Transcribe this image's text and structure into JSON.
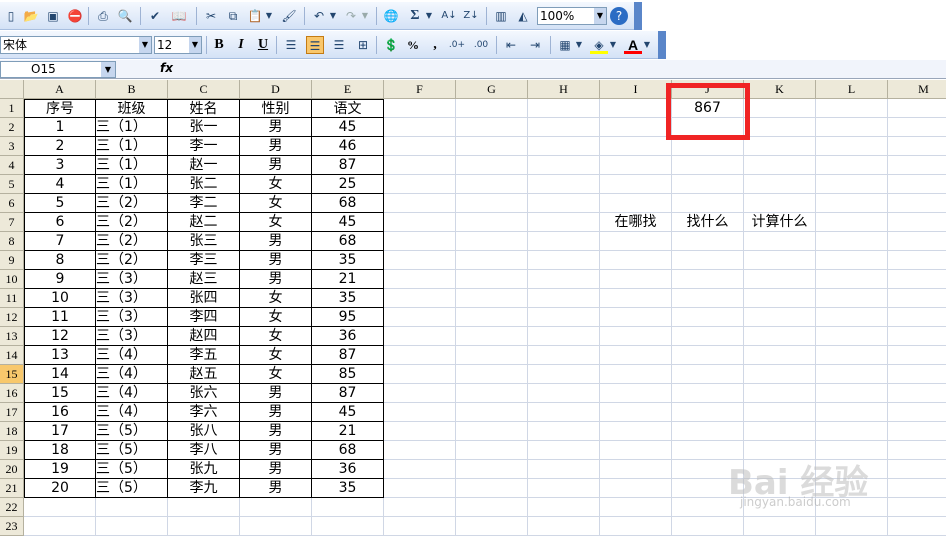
{
  "toolbar": {
    "zoom": "100%",
    "icons": [
      "new-file",
      "open",
      "save",
      "permission",
      "print",
      "print-preview",
      "spelling",
      "research",
      "cut",
      "copy",
      "paste",
      "format-painter",
      "undo",
      "redo",
      "hyperlink",
      "autosum",
      "sort-ascending",
      "sort-descending",
      "chart-wizard",
      "drawing",
      "zoom",
      "help"
    ]
  },
  "format_toolbar": {
    "font": "宋体",
    "size": "12",
    "bold": "B",
    "italic": "I",
    "underline": "U",
    "percent": "%",
    "comma": ","
  },
  "formula_bar": {
    "name_box": "O15",
    "fx": "fx",
    "formula": ""
  },
  "columns": [
    "A",
    "B",
    "C",
    "D",
    "E",
    "F",
    "G",
    "H",
    "I",
    "J",
    "K",
    "L",
    "M"
  ],
  "rows": [
    "1",
    "2",
    "3",
    "4",
    "5",
    "6",
    "7",
    "8",
    "9",
    "10",
    "11",
    "12",
    "13",
    "14",
    "15",
    "16",
    "17",
    "18",
    "19",
    "20",
    "21",
    "22",
    "23"
  ],
  "selected_row": "15",
  "table": {
    "headers": [
      "序号",
      "班级",
      "姓名",
      "性别",
      "语文"
    ],
    "rows": [
      [
        "1",
        "三（1）",
        "张一",
        "男",
        "45"
      ],
      [
        "2",
        "三（1）",
        "李一",
        "男",
        "46"
      ],
      [
        "3",
        "三（1）",
        "赵一",
        "男",
        "87"
      ],
      [
        "4",
        "三（1）",
        "张二",
        "女",
        "25"
      ],
      [
        "5",
        "三（2）",
        "李二",
        "女",
        "68"
      ],
      [
        "6",
        "三（2）",
        "赵二",
        "女",
        "45"
      ],
      [
        "7",
        "三（2）",
        "张三",
        "男",
        "68"
      ],
      [
        "8",
        "三（2）",
        "李三",
        "男",
        "35"
      ],
      [
        "9",
        "三（3）",
        "赵三",
        "男",
        "21"
      ],
      [
        "10",
        "三（3）",
        "张四",
        "女",
        "35"
      ],
      [
        "11",
        "三（3）",
        "李四",
        "女",
        "95"
      ],
      [
        "12",
        "三（3）",
        "赵四",
        "女",
        "36"
      ],
      [
        "13",
        "三（4）",
        "李五",
        "女",
        "87"
      ],
      [
        "14",
        "三（4）",
        "赵五",
        "女",
        "85"
      ],
      [
        "15",
        "三（4）",
        "张六",
        "男",
        "87"
      ],
      [
        "16",
        "三（4）",
        "李六",
        "男",
        "45"
      ],
      [
        "17",
        "三（5）",
        "张八",
        "男",
        "21"
      ],
      [
        "18",
        "三（5）",
        "李八",
        "男",
        "68"
      ],
      [
        "19",
        "三（5）",
        "张九",
        "男",
        "36"
      ],
      [
        "20",
        "三（5）",
        "李九",
        "男",
        "35"
      ]
    ]
  },
  "j1_value": "867",
  "labels": {
    "where": "在哪找",
    "what": "找什么",
    "calc": "计算什么"
  },
  "watermark": {
    "main": "Bai 经验",
    "sub": "jingyan.baidu.com"
  }
}
